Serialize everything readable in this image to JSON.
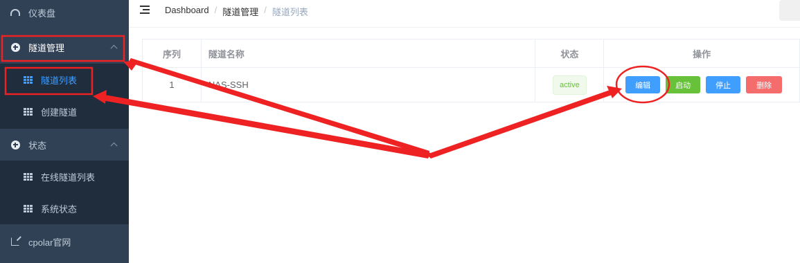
{
  "sidebar": {
    "dashboard": {
      "label": "仪表盘",
      "icon": "dashboard-icon"
    },
    "tunnel_mgmt": {
      "label": "隧道管理",
      "icon": "plus-circle-icon"
    },
    "tunnel_list": {
      "label": "隧道列表",
      "icon": "table-icon"
    },
    "create_tunnel": {
      "label": "创建隧道",
      "icon": "table-icon"
    },
    "status": {
      "label": "状态",
      "icon": "plus-circle-icon"
    },
    "online_tunnels": {
      "label": "在线隧道列表",
      "icon": "table-icon"
    },
    "system_status": {
      "label": "系统状态",
      "icon": "table-icon"
    },
    "cpolar_site": {
      "label": "cpolar官网",
      "icon": "external-link-icon"
    }
  },
  "header": {
    "breadcrumb": [
      "Dashboard",
      "隧道管理",
      "隧道列表"
    ],
    "separator": "/"
  },
  "table": {
    "columns": [
      "序列",
      "隧道名称",
      "状态",
      "操作"
    ],
    "rows": [
      {
        "index": "1",
        "name": "NAS-SSH",
        "status": "active"
      }
    ],
    "actions": {
      "edit": "编辑",
      "start": "启动",
      "stop": "停止",
      "delete": "删除"
    }
  },
  "colors": {
    "sidebar_bg": "#304156",
    "submenu_bg": "#1f2d3d",
    "accent": "#409eff",
    "success": "#67c23a",
    "danger": "#f56c6c",
    "annotation": "#ee2222"
  }
}
